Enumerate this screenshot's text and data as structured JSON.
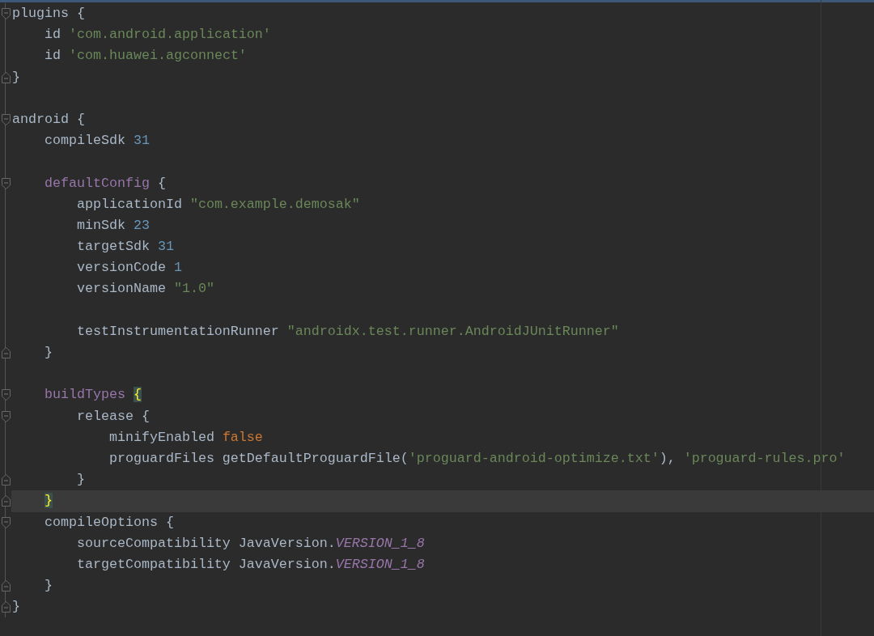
{
  "editor": {
    "lines": [
      {
        "kind": "open",
        "current": false,
        "tokens": [
          {
            "t": "plugins {",
            "kind": "plain"
          }
        ],
        "children": [
          {
            "kind": "plain",
            "current": false,
            "tokens": [
              {
                "t": "id ",
                "kind": "plain"
              },
              {
                "t": "'com.android.application'",
                "kind": "string"
              }
            ]
          },
          {
            "kind": "plain",
            "current": false,
            "tokens": [
              {
                "t": "id ",
                "kind": "plain"
              },
              {
                "t": "'com.huawei.agconnect'",
                "kind": "string"
              }
            ]
          }
        ]
      },
      {
        "kind": "close",
        "current": false,
        "tokens": [
          {
            "t": "}",
            "kind": "plain"
          }
        ]
      },
      {
        "kind": "plain",
        "current": false
      },
      {
        "kind": "open",
        "current": false,
        "tokens": [
          {
            "t": "android {",
            "kind": "plain"
          }
        ],
        "children": [
          {
            "kind": "plain",
            "current": false,
            "tokens": [
              {
                "t": "compileSdk ",
                "kind": "plain"
              },
              {
                "t": "31",
                "kind": "number"
              }
            ]
          },
          {
            "kind": "plain",
            "current": false
          },
          {
            "kind": "open",
            "current": false,
            "tokens": [
              {
                "t": "defaultConfig",
                "kind": "field"
              },
              {
                "t": " {",
                "kind": "plain"
              }
            ],
            "children": [
              {
                "kind": "plain",
                "current": false,
                "tokens": [
                  {
                    "t": "applicationId ",
                    "kind": "plain"
                  },
                  {
                    "t": "\"com.example.demosak\"",
                    "kind": "string"
                  }
                ]
              },
              {
                "kind": "plain",
                "current": false,
                "tokens": [
                  {
                    "t": "minSdk ",
                    "kind": "plain"
                  },
                  {
                    "t": "23",
                    "kind": "number"
                  }
                ]
              },
              {
                "kind": "plain",
                "current": false,
                "tokens": [
                  {
                    "t": "targetSdk ",
                    "kind": "plain"
                  },
                  {
                    "t": "31",
                    "kind": "number"
                  }
                ]
              },
              {
                "kind": "plain",
                "current": false,
                "tokens": [
                  {
                    "t": "versionCode ",
                    "kind": "plain"
                  },
                  {
                    "t": "1",
                    "kind": "number"
                  }
                ]
              },
              {
                "kind": "plain",
                "current": false,
                "tokens": [
                  {
                    "t": "versionName ",
                    "kind": "plain"
                  },
                  {
                    "t": "\"1.0\"",
                    "kind": "string"
                  }
                ]
              },
              {
                "kind": "plain",
                "current": false
              },
              {
                "kind": "plain",
                "current": false,
                "tokens": [
                  {
                    "t": "testInstrumentationRunner ",
                    "kind": "plain"
                  },
                  {
                    "t": "\"androidx.test.runner.AndroidJUnitRunner\"",
                    "kind": "string"
                  }
                ]
              }
            ]
          },
          {
            "kind": "close",
            "current": false,
            "tokens": [
              {
                "t": "}",
                "kind": "plain"
              }
            ]
          },
          {
            "kind": "plain",
            "current": false
          },
          {
            "kind": "open",
            "current": false,
            "tokens": [
              {
                "t": "buildTypes ",
                "kind": "field"
              },
              {
                "t": "{",
                "kind": "plain",
                "matched": true
              }
            ],
            "children": [
              {
                "kind": "open",
                "current": false,
                "tokens": [
                  {
                    "t": "release {",
                    "kind": "plain"
                  }
                ],
                "children": [
                  {
                    "kind": "plain",
                    "current": false,
                    "tokens": [
                      {
                        "t": "minifyEnabled ",
                        "kind": "plain"
                      },
                      {
                        "t": "false",
                        "kind": "keyword"
                      }
                    ]
                  },
                  {
                    "kind": "plain",
                    "current": false,
                    "tokens": [
                      {
                        "t": "proguardFiles getDefaultProguardFile(",
                        "kind": "plain"
                      },
                      {
                        "t": "'proguard-android-optimize.txt'",
                        "kind": "string"
                      },
                      {
                        "t": "), ",
                        "kind": "plain"
                      },
                      {
                        "t": "'proguard-rules.pro'",
                        "kind": "string"
                      }
                    ]
                  }
                ]
              },
              {
                "kind": "close",
                "current": false,
                "tokens": [
                  {
                    "t": "}",
                    "kind": "plain"
                  }
                ]
              }
            ]
          },
          {
            "kind": "close",
            "current": true,
            "tokens": [
              {
                "t": "}",
                "kind": "plain",
                "matched": true
              }
            ]
          },
          {
            "kind": "open",
            "current": false,
            "tokens": [
              {
                "t": "compileOptions {",
                "kind": "plain"
              }
            ],
            "children": [
              {
                "kind": "plain",
                "current": false,
                "tokens": [
                  {
                    "t": "sourceCompatibility JavaVersion.",
                    "kind": "plain"
                  },
                  {
                    "t": "VERSION_1_8",
                    "kind": "constant"
                  }
                ]
              },
              {
                "kind": "plain",
                "current": false,
                "tokens": [
                  {
                    "t": "targetCompatibility JavaVersion.",
                    "kind": "plain"
                  },
                  {
                    "t": "VERSION_1_8",
                    "kind": "constant"
                  }
                ]
              }
            ]
          },
          {
            "kind": "close",
            "current": false,
            "tokens": [
              {
                "t": "}",
                "kind": "plain"
              }
            ]
          }
        ]
      },
      {
        "kind": "close",
        "current": false,
        "tokens": [
          {
            "t": "}",
            "kind": "plain"
          }
        ]
      }
    ]
  }
}
